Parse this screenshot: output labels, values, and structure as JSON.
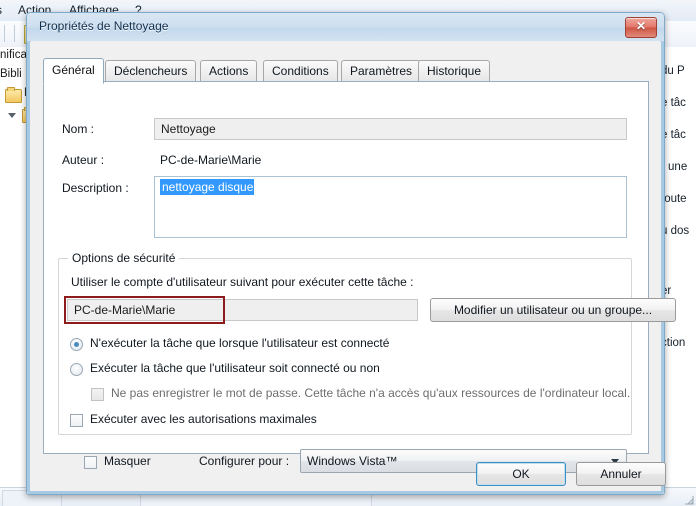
{
  "background_window": {
    "menubar": {
      "items": [
        {
          "label": "s",
          "partial": true
        },
        {
          "label": "Action"
        },
        {
          "label": "Affichage"
        },
        {
          "label": "?"
        }
      ]
    },
    "tree_pane": {
      "items": [
        {
          "label": "nifica"
        },
        {
          "label": "Bibli"
        },
        {
          "label": "M"
        },
        {
          "label": ""
        }
      ]
    },
    "action_pane": {
      "items": [
        {
          "label": "du P"
        },
        {
          "label": "e tâc"
        },
        {
          "label": "e tâc"
        },
        {
          "label": "r une"
        },
        {
          "label": "toute"
        },
        {
          "label": "u dos"
        },
        {
          "label": "er"
        },
        {
          "label": "ction"
        }
      ]
    }
  },
  "dialog": {
    "title": "Propriétés de Nettoyage",
    "close_label": "✕",
    "tabs": [
      {
        "label": "Général",
        "active": true
      },
      {
        "label": "Déclencheurs",
        "active": false
      },
      {
        "label": "Actions",
        "active": false
      },
      {
        "label": "Conditions",
        "active": false
      },
      {
        "label": "Paramètres",
        "active": false
      },
      {
        "label": "Historique",
        "active": false
      }
    ],
    "general": {
      "name_label": "Nom :",
      "name_value": "Nettoyage",
      "author_label": "Auteur :",
      "author_value": "PC-de-Marie\\Marie",
      "description_label": "Description :",
      "description_value": "nettoyage disque",
      "security": {
        "group_title": "Options de sécurité",
        "account_prompt": "Utiliser le compte d'utilisateur suivant pour exécuter cette tâche :",
        "account_value": "PC-de-Marie\\Marie",
        "change_user_button": "Modifier un utilisateur ou un groupe...",
        "radio_run_only_logged_on": "N'exécuter la tâche que lorsque l'utilisateur est connecté",
        "radio_run_whether_or_not": "Exécuter la tâche que l'utilisateur soit connecté ou non",
        "checkbox_no_store_password": "Ne pas enregistrer le mot de passe. Cette tâche n'a accès qu'aux ressources de l'ordinateur local.",
        "checkbox_highest_privileges": "Exécuter avec les autorisations maximales",
        "selected_radio": "run_only_logged_on"
      },
      "hidden_label": "Masquer",
      "configure_for_label": "Configurer pour :",
      "configure_for_value": "Windows Vista™"
    },
    "footer": {
      "ok_label": "OK",
      "cancel_label": "Annuler"
    }
  },
  "colors": {
    "accent_selection": "#3399ff",
    "annotation_red": "#8e1b1b",
    "title_gradient_top": "#d9e6f3",
    "close_button_red": "#cf5544",
    "default_button_focus": "#3c8fc0"
  }
}
